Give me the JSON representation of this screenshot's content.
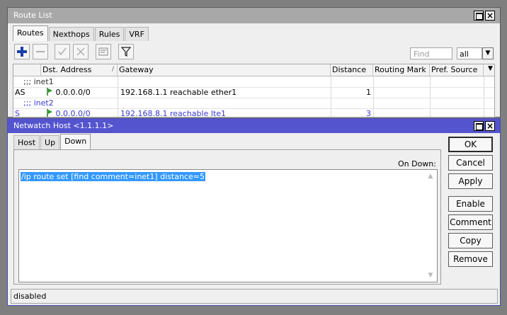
{
  "route_window": {
    "title": "Route List",
    "tabs": [
      "Routes",
      "Nexthops",
      "Rules",
      "VRF"
    ],
    "find_placeholder": "Find",
    "filter_value": "all",
    "columns": [
      "Dst. Address",
      "Gateway",
      "Distance",
      "Routing Mark",
      "Pref. Source"
    ],
    "sort_indicator": "/",
    "rows": [
      {
        "type": "comment",
        "text": ";;; inet1"
      },
      {
        "type": "route",
        "flags": "AS",
        "dst": "0.0.0.0/0",
        "gateway": "192.168.1.1 reachable ether1",
        "distance": "1",
        "routing_mark": "",
        "pref_source": "",
        "color": "#000000"
      },
      {
        "type": "comment",
        "text": ";;; inet2"
      },
      {
        "type": "route",
        "flags": "S",
        "dst": "0.0.0.0/0",
        "gateway": "192.168.8.1 reachable lte1",
        "distance": "3",
        "routing_mark": "",
        "pref_source": "",
        "color": "#3a3ad0"
      }
    ]
  },
  "netwatch_window": {
    "title": "Netwatch Host <1.1.1.1>",
    "tabs": [
      "Host",
      "Up",
      "Down"
    ],
    "active_tab": "Down",
    "field_label": "On Down:",
    "script": "/ip route set [find comment=inet1] distance=5",
    "buttons": [
      "OK",
      "Cancel",
      "Apply",
      "Enable",
      "Comment",
      "Copy",
      "Remove"
    ],
    "status": "disabled"
  },
  "colors": {
    "active_title": "#5454cf",
    "inactive_title": "#a8a8a8",
    "selection": "#3399ff",
    "dynamic_route": "#3a3ad0"
  }
}
